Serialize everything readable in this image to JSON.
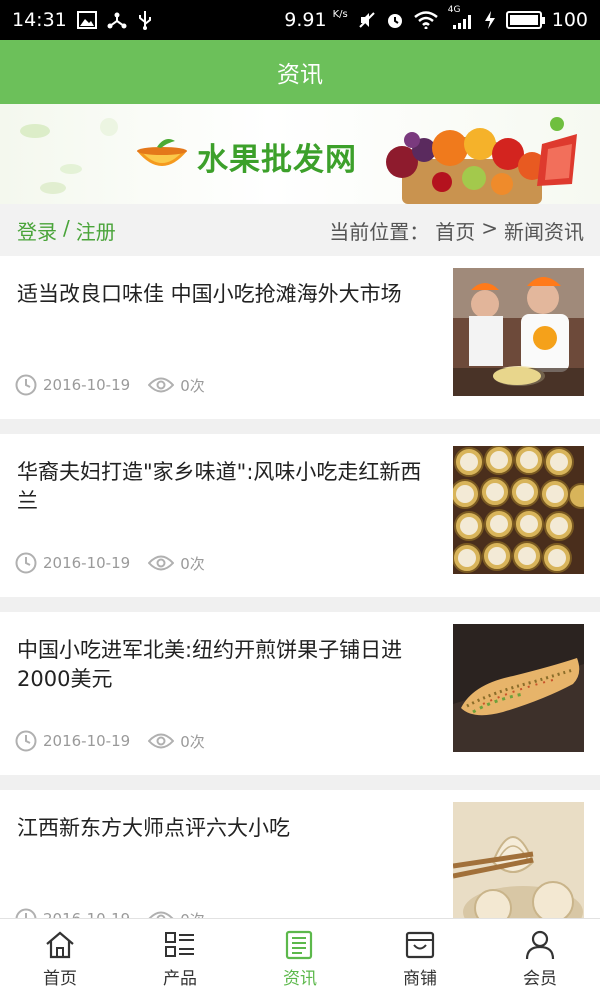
{
  "status_bar": {
    "time": "14:31",
    "speed": "9.91",
    "speed_unit": "K/s",
    "network": "4G",
    "battery": "100"
  },
  "header": {
    "title": "资讯"
  },
  "banner": {
    "title": "水果批发网"
  },
  "auth": {
    "login": "登录",
    "separator": "/",
    "register": "注册"
  },
  "breadcrumb": {
    "prefix": "当前位置：",
    "home": "首页",
    "separator": ">",
    "current": "新闻资讯"
  },
  "news": [
    {
      "title": "适当改良口味佳 中国小吃抢滩海外大市场",
      "date": "2016-10-19",
      "views": "0次"
    },
    {
      "title": "华裔夫妇打造\"家乡味道\":风味小吃走红新西兰",
      "date": "2016-10-19",
      "views": "0次"
    },
    {
      "title": "中国小吃进军北美:纽约开煎饼果子铺日进2000美元",
      "date": "2016-10-19",
      "views": "0次"
    },
    {
      "title": "江西新东方大师点评六大小吃",
      "date": "2016-10-19",
      "views": "0次"
    }
  ],
  "nav": [
    {
      "label": "首页",
      "icon": "home-icon"
    },
    {
      "label": "产品",
      "icon": "grid-list-icon"
    },
    {
      "label": "资讯",
      "icon": "news-icon",
      "active": true
    },
    {
      "label": "商铺",
      "icon": "shop-icon"
    },
    {
      "label": "会员",
      "icon": "user-icon"
    }
  ],
  "colors": {
    "accent": "#6cc05a",
    "auth_link": "#4aa43a",
    "meta": "#9a9a9a"
  }
}
